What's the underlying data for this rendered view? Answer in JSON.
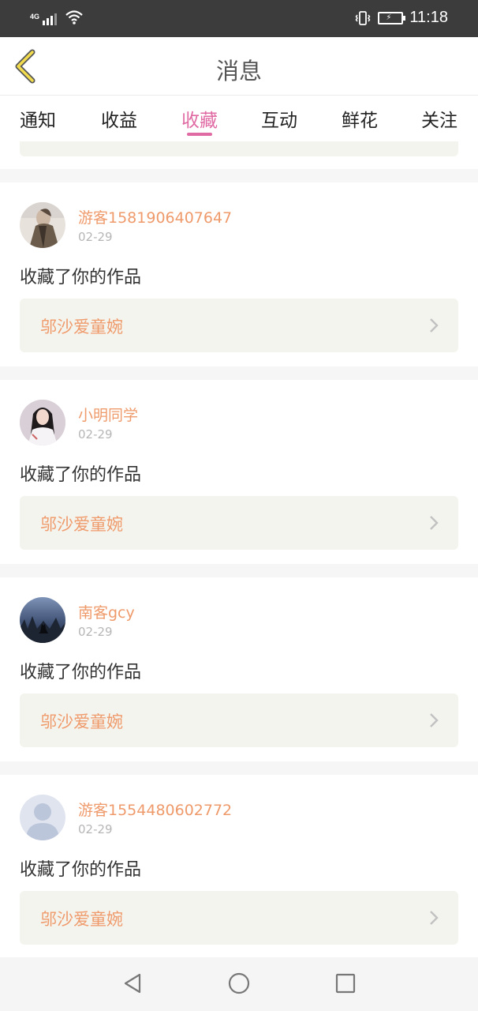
{
  "status_bar": {
    "network": "4G",
    "time": "11:18",
    "icons": [
      "signal-icon",
      "wifi-icon",
      "vibrate-icon",
      "battery-charging-icon"
    ]
  },
  "header": {
    "title": "消息",
    "back_icon": "chevron-left-icon"
  },
  "tabs": [
    {
      "label": "通知",
      "active": false
    },
    {
      "label": "收益",
      "active": false
    },
    {
      "label": "收藏",
      "active": true
    },
    {
      "label": "互动",
      "active": false
    },
    {
      "label": "鲜花",
      "active": false
    },
    {
      "label": "关注",
      "active": false
    }
  ],
  "colors": {
    "accent_pink": "#e06aa3",
    "name_orange": "#ef9a6b",
    "card_bg": "#f4f4ee",
    "status_bar_bg": "#3c3c3c"
  },
  "messages": [
    {
      "username": "游客1581906407647",
      "date": "02-29",
      "action": "收藏了你的作品",
      "work_title": "邬沙爱童婉",
      "avatar": "avatar-photo-person-coat"
    },
    {
      "username": "小明同学",
      "date": "02-29",
      "action": "收藏了你的作品",
      "work_title": "邬沙爱童婉",
      "avatar": "avatar-photo-girl"
    },
    {
      "username": "南客gcy",
      "date": "02-29",
      "action": "收藏了你的作品",
      "work_title": "邬沙爱童婉",
      "avatar": "avatar-photo-wolf-night"
    },
    {
      "username": "游客1554480602772",
      "date": "02-29",
      "action": "收藏了你的作品",
      "work_title": "邬沙爱童婉",
      "avatar": "avatar-default-silhouette"
    }
  ],
  "nav_bar": {
    "buttons": [
      "back-triangle-icon",
      "home-circle-icon",
      "recents-square-icon"
    ]
  }
}
